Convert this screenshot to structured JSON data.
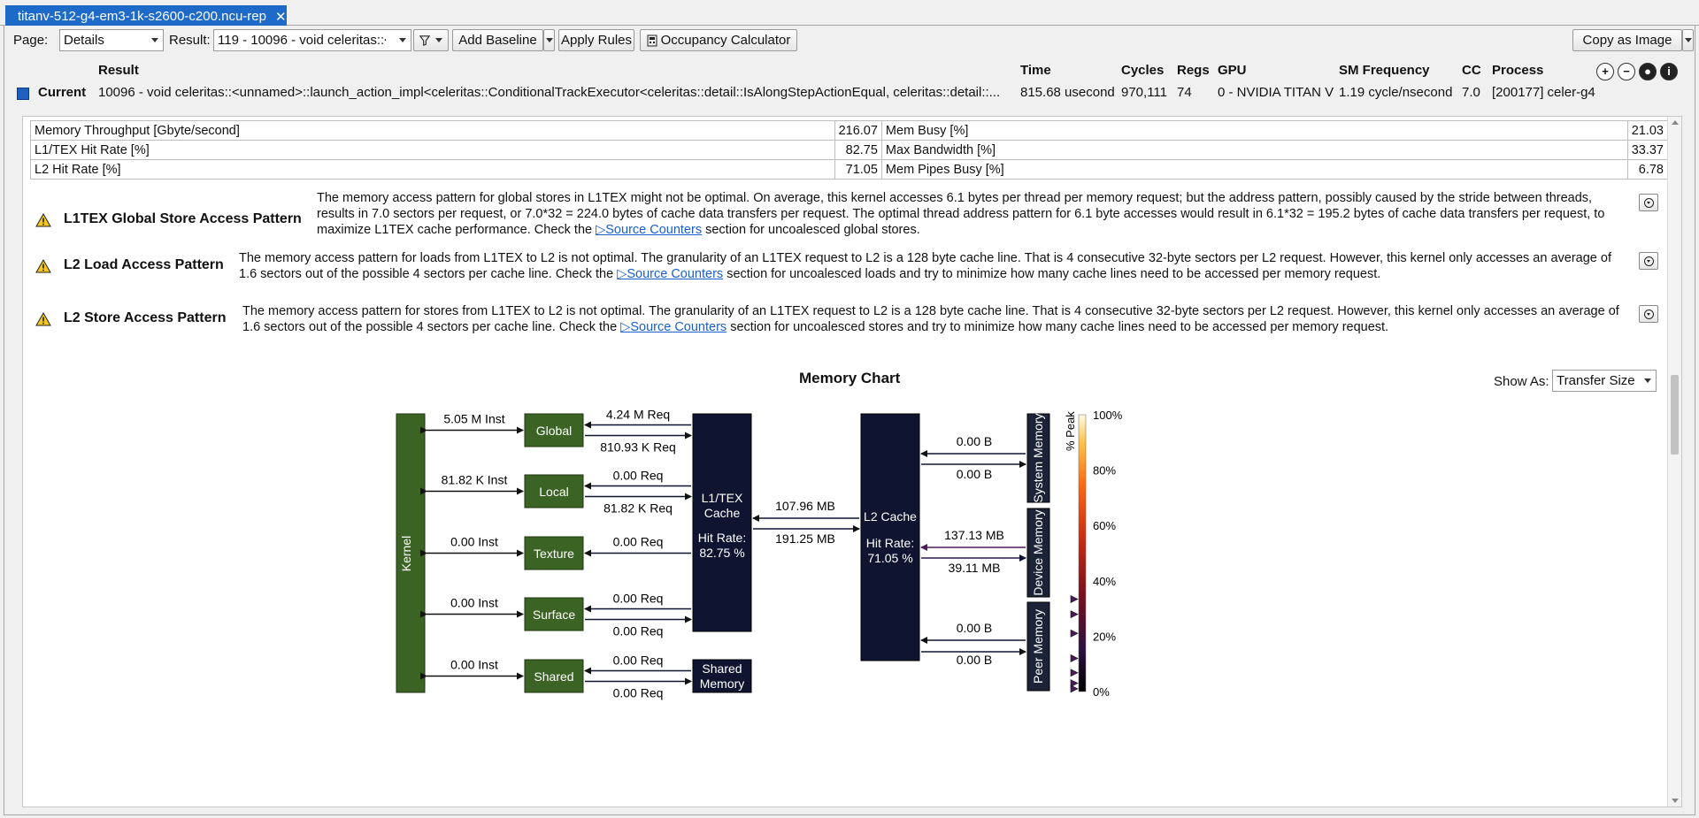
{
  "tab": {
    "title": "titanv-512-g4-em3-1k-s2600-c200.ncu-rep",
    "close": "✕"
  },
  "toolbar": {
    "page_label": "Page:",
    "page_value": "Details",
    "result_label": "Result:",
    "result_value": "119 - 10096 - void celeritas::<",
    "add_baseline": "Add Baseline",
    "apply_rules": "Apply Rules",
    "occupancy_calculator": "Occupancy Calculator",
    "copy_as_image": "Copy as Image"
  },
  "result_header": {
    "columns": [
      "Result",
      "Time",
      "Cycles",
      "Regs",
      "GPU",
      "SM Frequency",
      "CC",
      "Process"
    ],
    "row_label": "Current",
    "row": {
      "result": "10096 - void celeritas::<unnamed>::launch_action_impl<celeritas::ConditionalTrackExecutor<celeritas::detail::IsAlongStepActionEqual, celeritas::detail::...",
      "time": "815.68 usecond",
      "cycles": "970,111",
      "regs": "74",
      "gpu": "0 - NVIDIA TITAN V",
      "sm_frequency": "1.19 cycle/nsecond",
      "cc": "7.0",
      "process": "[200177] celer-g4"
    },
    "colors": {
      "current_marker": "#1f5fbf"
    }
  },
  "metrics": [
    {
      "label": "Memory Throughput [Gbyte/second]",
      "value": "216.07",
      "label2": "Mem Busy [%]",
      "value2": "21.03"
    },
    {
      "label": "L1/TEX Hit Rate [%]",
      "value": "82.75",
      "label2": "Max Bandwidth [%]",
      "value2": "33.37"
    },
    {
      "label": "L2 Hit Rate [%]",
      "value": "71.05",
      "label2": "Mem Pipes Busy [%]",
      "value2": "6.78"
    }
  ],
  "rules": [
    {
      "title": "L1TEX Global Store Access Pattern",
      "text_a": "The memory access pattern for global stores in L1TEX might not be optimal. On average, this kernel accesses 6.1 bytes per thread per memory request; but the address pattern, possibly caused by the stride between threads, results in 7.0 sectors per request, or 7.0*32 = 224.0 bytes of cache data transfers per request. The optimal thread address pattern for 6.1 byte accesses would result in 6.1*32 = 195.2 bytes of cache data transfers per request, to maximize L1TEX cache performance. Check the",
      "link": "Source Counters",
      "text_b": "section for uncoalesced global stores."
    },
    {
      "title": "L2 Load Access Pattern",
      "text_a": "The memory access pattern for loads from L1TEX to L2 is not optimal. The granularity of an L1TEX request to L2 is a 128 byte cache line. That is 4 consecutive 32-byte sectors per L2 request. However, this kernel only accesses an average of 1.6 sectors out of the possible 4 sectors per cache line. Check the",
      "link": "Source Counters",
      "text_b": "section for uncoalesced loads and try to minimize how many cache lines need to be accessed per memory request."
    },
    {
      "title": "L2 Store Access Pattern",
      "text_a": "The memory access pattern for stores from L1TEX to L2 is not optimal. The granularity of an L1TEX request to L2 is a 128 byte cache line. That is 4 consecutive 32-byte sectors per L2 request. However, this kernel only accesses an average of 1.6 sectors out of the possible 4 sectors per cache line. Check the",
      "link": "Source Counters",
      "text_b": "section for uncoalesced stores and try to minimize how many cache lines need to be accessed per memory request."
    }
  ],
  "memory_chart": {
    "title": "Memory Chart",
    "show_as_label": "Show As:",
    "show_as_value": "Transfer Size",
    "kernel": "Kernel",
    "units": [
      {
        "name": "Global",
        "inst": "5.05 M Inst",
        "req_out": "4.24 M Req",
        "req_in": "810.93 K Req"
      },
      {
        "name": "Local",
        "inst": "81.82 K Inst",
        "req_out": "0.00 Req",
        "req_in": "81.82 K Req"
      },
      {
        "name": "Texture",
        "inst": "0.00 Inst",
        "req_out": "0.00 Req"
      },
      {
        "name": "Surface",
        "inst": "0.00 Inst",
        "req_out": "0.00 Req",
        "req_in": "0.00 Req"
      },
      {
        "name": "Shared",
        "inst": "0.00 Inst",
        "req_out": "0.00 Req",
        "req_in": "0.00 Req"
      }
    ],
    "l1": {
      "name_line1": "L1/TEX",
      "name_line2": "Cache",
      "hit_label": "Hit Rate:",
      "hit_value": "82.75 %"
    },
    "shared_memory": {
      "line1": "Shared",
      "line2": "Memory"
    },
    "l1_l2": {
      "to_l1": "107.96 MB",
      "to_l2": "191.25 MB"
    },
    "l2": {
      "name": "L2 Cache",
      "hit_label": "Hit Rate:",
      "hit_value": "71.05 %"
    },
    "system_memory": {
      "name": "System Memory",
      "in": "0.00 B",
      "out": "0.00 B"
    },
    "device_memory": {
      "name": "Device Memory",
      "in": "137.13 MB",
      "out": "39.11 MB"
    },
    "peer_memory": {
      "name": "Peer Memory",
      "in": "0.00 B",
      "out": "0.00 B"
    },
    "legend": {
      "title": "% Peak",
      "ticks": [
        "100%",
        "80%",
        "60%",
        "40%",
        "20%",
        "0%"
      ],
      "markers": [
        33.4,
        27.9,
        21.0,
        12.0,
        6.8,
        3.0,
        1.0
      ]
    },
    "colors": {
      "unit_green": "#3b6424",
      "cache_navy": "#0f1530",
      "mem_navy": "#1c2336",
      "edge": "#0f1530",
      "purple_edge": "#4b1a5a"
    }
  }
}
